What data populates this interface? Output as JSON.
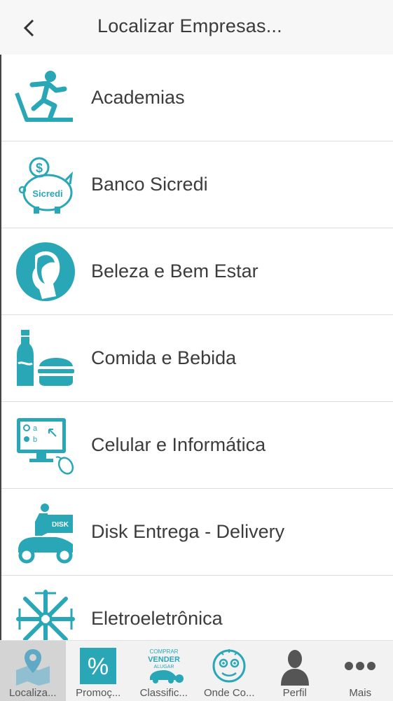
{
  "header": {
    "title": "Localizar Empresas..."
  },
  "categories": [
    {
      "label": "Academias",
      "icon": "runner-treadmill-icon"
    },
    {
      "label": "Banco Sicredi",
      "icon": "piggy-bank-icon",
      "icon_text": "Sicredi"
    },
    {
      "label": "Beleza e Bem Estar",
      "icon": "woman-profile-icon"
    },
    {
      "label": "Comida e Bebida",
      "icon": "bottle-burger-icon"
    },
    {
      "label": "Celular e Informática",
      "icon": "computer-mouse-icon",
      "icon_text_a": "a",
      "icon_text_b": "b"
    },
    {
      "label": "Disk Entrega - Delivery",
      "icon": "delivery-scooter-icon",
      "icon_text": "DISK"
    },
    {
      "label": "Eletroeletrônica",
      "icon": "appliance-fan-icon"
    }
  ],
  "tabbar": {
    "tabs": [
      {
        "label": "Localiza...",
        "icon": "map-pin-icon",
        "active": true
      },
      {
        "label": "Promoç...",
        "icon": "percent-icon",
        "icon_text": "%"
      },
      {
        "label": "Classific...",
        "icon": "classifieds-icon",
        "icon_line1": "COMPRAR",
        "icon_line2": "VENDER",
        "icon_line3": "ALUGAR"
      },
      {
        "label": "Onde Co...",
        "icon": "smiley-face-icon"
      },
      {
        "label": "Perfil",
        "icon": "person-icon"
      },
      {
        "label": "Mais",
        "icon": "more-dots-icon"
      }
    ]
  },
  "colors": {
    "accent": "#2aa7b7",
    "text": "#3c3c3c",
    "header_bg": "#f7f7f7",
    "tabbar_bg": "#f2f2f2"
  }
}
